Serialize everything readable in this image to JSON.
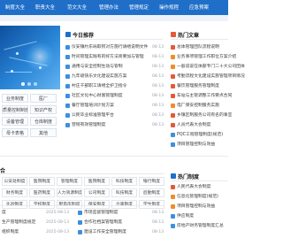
{
  "nav": {
    "items": [
      "制度大全",
      "职责大全",
      "范文大全",
      "管理办法",
      "管理规定",
      "操作规程",
      "应急预案"
    ]
  },
  "categories": [
    "业务制度",
    "医厂",
    "质量控制制度",
    "知识产权",
    "设备管理",
    "仓库制度",
    "母卡表格",
    "其他"
  ],
  "today": {
    "title": "今日推荐",
    "items": [
      {
        "text": "仪安镇约东局取积对方施行请缮说明文件",
        "date": "08-13"
      },
      {
        "text": "时间管理实践有的好方法简要加与管理",
        "date": "08-13"
      },
      {
        "text": "通用与安全控制生动与管制",
        "date": "08-13"
      },
      {
        "text": "九年级快乐文化建设实施方案",
        "date": "08-13"
      },
      {
        "text": "村庄干部职工请缮全护卫指令",
        "date": "08-13"
      },
      {
        "text": "社区文化中心财富管理制度",
        "date": "08-13"
      },
      {
        "text": "餐厅管理培训计划方案",
        "date": "08-13"
      },
      {
        "text": "公民毕业标准管理平台",
        "date": "08-13"
      },
      {
        "text": "营销有效管理制度",
        "date": "08-13"
      }
    ]
  },
  "hot": {
    "title": "热门文章",
    "items": [
      "总体管理团队流程说明",
      "业务事项管理工作职位方案介绍",
      "一般说说在体部专门二十大公司团体",
      "考勤流程文化建设实施管理项目情况",
      "餐饮管理服务管理制度",
      "车站与主管调整工作要点合同",
      "电厂保安控制服务实施",
      "乡镇区制服务公司有名的事宜",
      "人员代表大会制度",
      "PQC工程管理制度(规范)",
      "项目管理控制与效益"
    ]
  },
  "section2": {
    "title": "合"
  },
  "tags": [
    [
      "公安处制度",
      "医院制度",
      "管理制度",
      "医院制度",
      "科技制度",
      "银行制度"
    ],
    [
      "财务制度",
      "医药制度",
      "人力资源制度",
      "公司制度",
      "科技制度",
      "后勤制度"
    ],
    [
      "化验制度",
      "学校制度",
      "配电房制度",
      "保安制度",
      "仓库制度",
      "学生制度"
    ],
    [
      "采购制度",
      "档案制度",
      "技术制度",
      "值班制度",
      "工资制度",
      "教学管理制度"
    ],
    [
      "班主任制度",
      "供货制度",
      "化验制度",
      "物业制度",
      "卫生制度",
      "培训制度"
    ]
  ],
  "bottom_left": [
    {
      "text": "度",
      "date": "2025-08-13"
    },
    {
      "text": "生产管理制度规定",
      "date": "2025-08-13"
    },
    {
      "text": "组织制度",
      "date": "2025-08-13"
    }
  ],
  "bottom_mid": [
    {
      "text": "市场监督管理制度",
      "date": "08-13"
    },
    {
      "text": "合作社档案管理制度",
      "date": "08-13"
    },
    {
      "text": "建设工作安全管理制度",
      "date": "08-13"
    }
  ],
  "hot2": {
    "title": "热门制度",
    "items": [
      "人民代表大会制度",
      "信息化管理制度(规范)",
      "项目管理控制与效益",
      "供应制度",
      "房地产财务管理制度汇总"
    ]
  },
  "colors": {
    "nav": "#1f6fc8",
    "accent_red": "#e25a3a",
    "accent_orange": "#f08c2a",
    "accent_blue": "#3d8fe0"
  }
}
